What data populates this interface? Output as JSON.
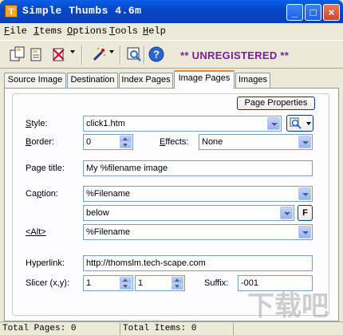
{
  "window": {
    "title": "Simple Thumbs 4.6m",
    "app_icon": "T"
  },
  "menu": [
    {
      "label": "File",
      "u": "F",
      "rest": "ile"
    },
    {
      "label": "Items",
      "u": "I",
      "rest": "tems"
    },
    {
      "label": "Options",
      "u": "O",
      "rest": "ptions"
    },
    {
      "label": "Tools",
      "u": "T",
      "rest": "ools"
    },
    {
      "label": "Help",
      "u": "H",
      "rest": "elp"
    }
  ],
  "toolbar": {
    "banner": "** UNREGISTERED **",
    "banner_color": "#7b1fa2"
  },
  "tabs": [
    "Source Image",
    "Destination",
    "Index Pages",
    "Image Pages",
    "Images"
  ],
  "active_tab": "Image Pages",
  "form": {
    "page_properties": "Page Properties",
    "style_label_u": "S",
    "style_label_rest": "tyle:",
    "style_value": "click1.htm",
    "border_label_u": "B",
    "border_label_rest": "order:",
    "border_value": "0",
    "effects_label_u": "E",
    "effects_label_rest": "ffects:",
    "effects_value": "None",
    "page_title_label": "Page title:",
    "page_title_value": "My %filename image",
    "caption_label_pre": "Ca",
    "caption_label_u": "p",
    "caption_label_rest": "tion:",
    "caption_value": "%Filename",
    "caption_position": "below",
    "font_button": "F",
    "alt_label": "<Alt>",
    "alt_value": "%Filename",
    "hyperlink_label": "Hyperlink:",
    "hyperlink_value": "http://thomslm.tech-scape.com",
    "slicer_label": "Slicer (x,y):",
    "slicer_x": "1",
    "slicer_y": "1",
    "suffix_label": "Suffix:",
    "suffix_value": "-001"
  },
  "status": {
    "total_pages": "Total Pages: 0",
    "total_items": "Total Items: 0"
  },
  "watermark": "下载吧"
}
